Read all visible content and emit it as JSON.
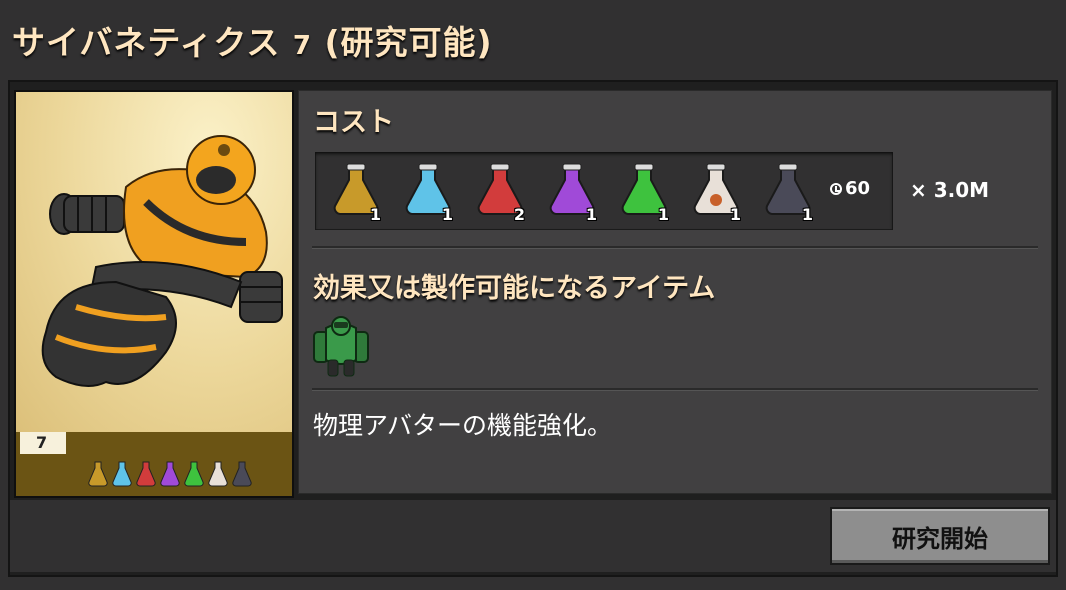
{
  "title": {
    "name": "サイバネティクス",
    "level": "7",
    "status": "(研究可能)"
  },
  "card": {
    "level": "7",
    "pack_icons": [
      "automation-science-pack-icon",
      "logistic-science-pack-icon",
      "military-science-pack-icon",
      "chemical-science-pack-icon",
      "production-science-pack-icon",
      "utility-science-pack-icon",
      "space-science-pack-icon"
    ]
  },
  "cost": {
    "heading": "コスト",
    "packs": [
      {
        "icon": "automation-science-pack-icon",
        "color": "#c89a2a",
        "count": "1"
      },
      {
        "icon": "logistic-science-pack-icon",
        "color": "#5fc3e8",
        "count": "1"
      },
      {
        "icon": "military-science-pack-icon",
        "color": "#d23c3c",
        "count": "2"
      },
      {
        "icon": "chemical-science-pack-icon",
        "color": "#a04ad8",
        "count": "1"
      },
      {
        "icon": "production-science-pack-icon",
        "color": "#3ec23e",
        "count": "1"
      },
      {
        "icon": "utility-science-pack-icon",
        "color": "#e8e0d8",
        "count": "1"
      },
      {
        "icon": "space-science-pack-icon",
        "color": "#4a4a58",
        "count": "1"
      }
    ],
    "time": "60",
    "multiplier": "× 3.0M"
  },
  "unlocks": {
    "heading": "効果又は製作可能になるアイテム",
    "items": [
      {
        "icon": "power-armor-icon",
        "color": "#3a9a4a"
      }
    ]
  },
  "description": "物理アバターの機能強化。",
  "start_button": "研究開始"
}
